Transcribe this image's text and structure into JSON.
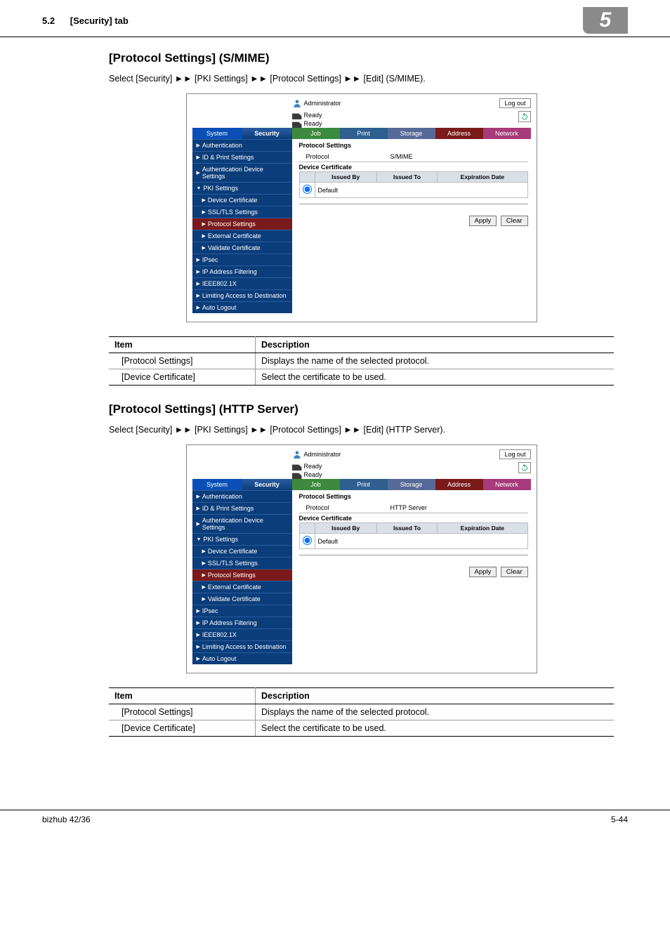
{
  "header": {
    "section": "5.2",
    "title": "[Security] tab",
    "chapter": "5"
  },
  "smime": {
    "heading": "[Protocol Settings] (S/MIME)",
    "breadcrumb": "Select [Security] ►► [PKI Settings] ►► [Protocol Settings] ►► [Edit] (S/MIME).",
    "ui": {
      "user": "Administrator",
      "logout": "Log out",
      "ready": "Ready",
      "tabs": {
        "system": "System",
        "security": "Security",
        "job": "Job",
        "print": "Print",
        "storage": "Storage",
        "address": "Address",
        "network": "Network"
      },
      "sidebar": [
        {
          "t": "Authentication"
        },
        {
          "t": "ID & Print Settings"
        },
        {
          "t": "Authentication Device Settings"
        },
        {
          "t": "PKI Settings",
          "open": true
        },
        {
          "t": "Device Certificate",
          "sub": true
        },
        {
          "t": "SSL/TLS Settings",
          "sub": true
        },
        {
          "t": "Protocol Settings",
          "sub": true,
          "current": true
        },
        {
          "t": "External Certificate",
          "sub": true
        },
        {
          "t": "Validate Certificate",
          "sub": true
        },
        {
          "t": "IPsec"
        },
        {
          "t": "IP Address Filtering"
        },
        {
          "t": "IEEE802.1X"
        },
        {
          "t": "Limiting Access to Destination"
        },
        {
          "t": "Auto Logout"
        }
      ],
      "main": {
        "title": "Protocol Settings",
        "protoLabel": "Protocol",
        "protoValue": "S/MIME",
        "dcTitle": "Device Certificate",
        "cols": {
          "by": "Issued By",
          "to": "Issued To",
          "exp": "Expiration Date"
        },
        "row": {
          "name": "Default"
        },
        "apply": "Apply",
        "clear": "Clear"
      }
    },
    "table": {
      "h1": "Item",
      "h2": "Description",
      "r1c1": "[Protocol Settings]",
      "r1c2": "Displays the name of the selected protocol.",
      "r2c1": "[Device Certificate]",
      "r2c2": "Select the certificate to be used."
    }
  },
  "http": {
    "heading": "[Protocol Settings] (HTTP Server)",
    "breadcrumb": "Select [Security] ►► [PKI Settings] ►► [Protocol Settings] ►► [Edit] (HTTP Server).",
    "ui": {
      "user": "Administrator",
      "logout": "Log out",
      "ready": "Ready",
      "tabs": {
        "system": "System",
        "security": "Security",
        "job": "Job",
        "print": "Print",
        "storage": "Storage",
        "address": "Address",
        "network": "Network"
      },
      "sidebar": [
        {
          "t": "Authentication"
        },
        {
          "t": "ID & Print Settings"
        },
        {
          "t": "Authentication Device Settings"
        },
        {
          "t": "PKI Settings",
          "open": true
        },
        {
          "t": "Device Certificate",
          "sub": true
        },
        {
          "t": "SSL/TLS Settings",
          "sub": true
        },
        {
          "t": "Protocol Settings",
          "sub": true,
          "current": true
        },
        {
          "t": "External Certificate",
          "sub": true
        },
        {
          "t": "Validate Certificate",
          "sub": true
        },
        {
          "t": "IPsec"
        },
        {
          "t": "IP Address Filtering"
        },
        {
          "t": "IEEE802.1X"
        },
        {
          "t": "Limiting Access to Destination"
        },
        {
          "t": "Auto Logout"
        }
      ],
      "main": {
        "title": "Protocol Settings",
        "protoLabel": "Protocol",
        "protoValue": "HTTP Server",
        "dcTitle": "Device Certificate",
        "cols": {
          "by": "Issued By",
          "to": "Issued To",
          "exp": "Expiration Date"
        },
        "row": {
          "name": "Default"
        },
        "apply": "Apply",
        "clear": "Clear"
      }
    },
    "table": {
      "h1": "Item",
      "h2": "Description",
      "r1c1": "[Protocol Settings]",
      "r1c2": "Displays the name of the selected protocol.",
      "r2c1": "[Device Certificate]",
      "r2c2": "Select the certificate to be used."
    }
  },
  "footer": {
    "product": "bizhub 42/36",
    "page": "5-44"
  }
}
